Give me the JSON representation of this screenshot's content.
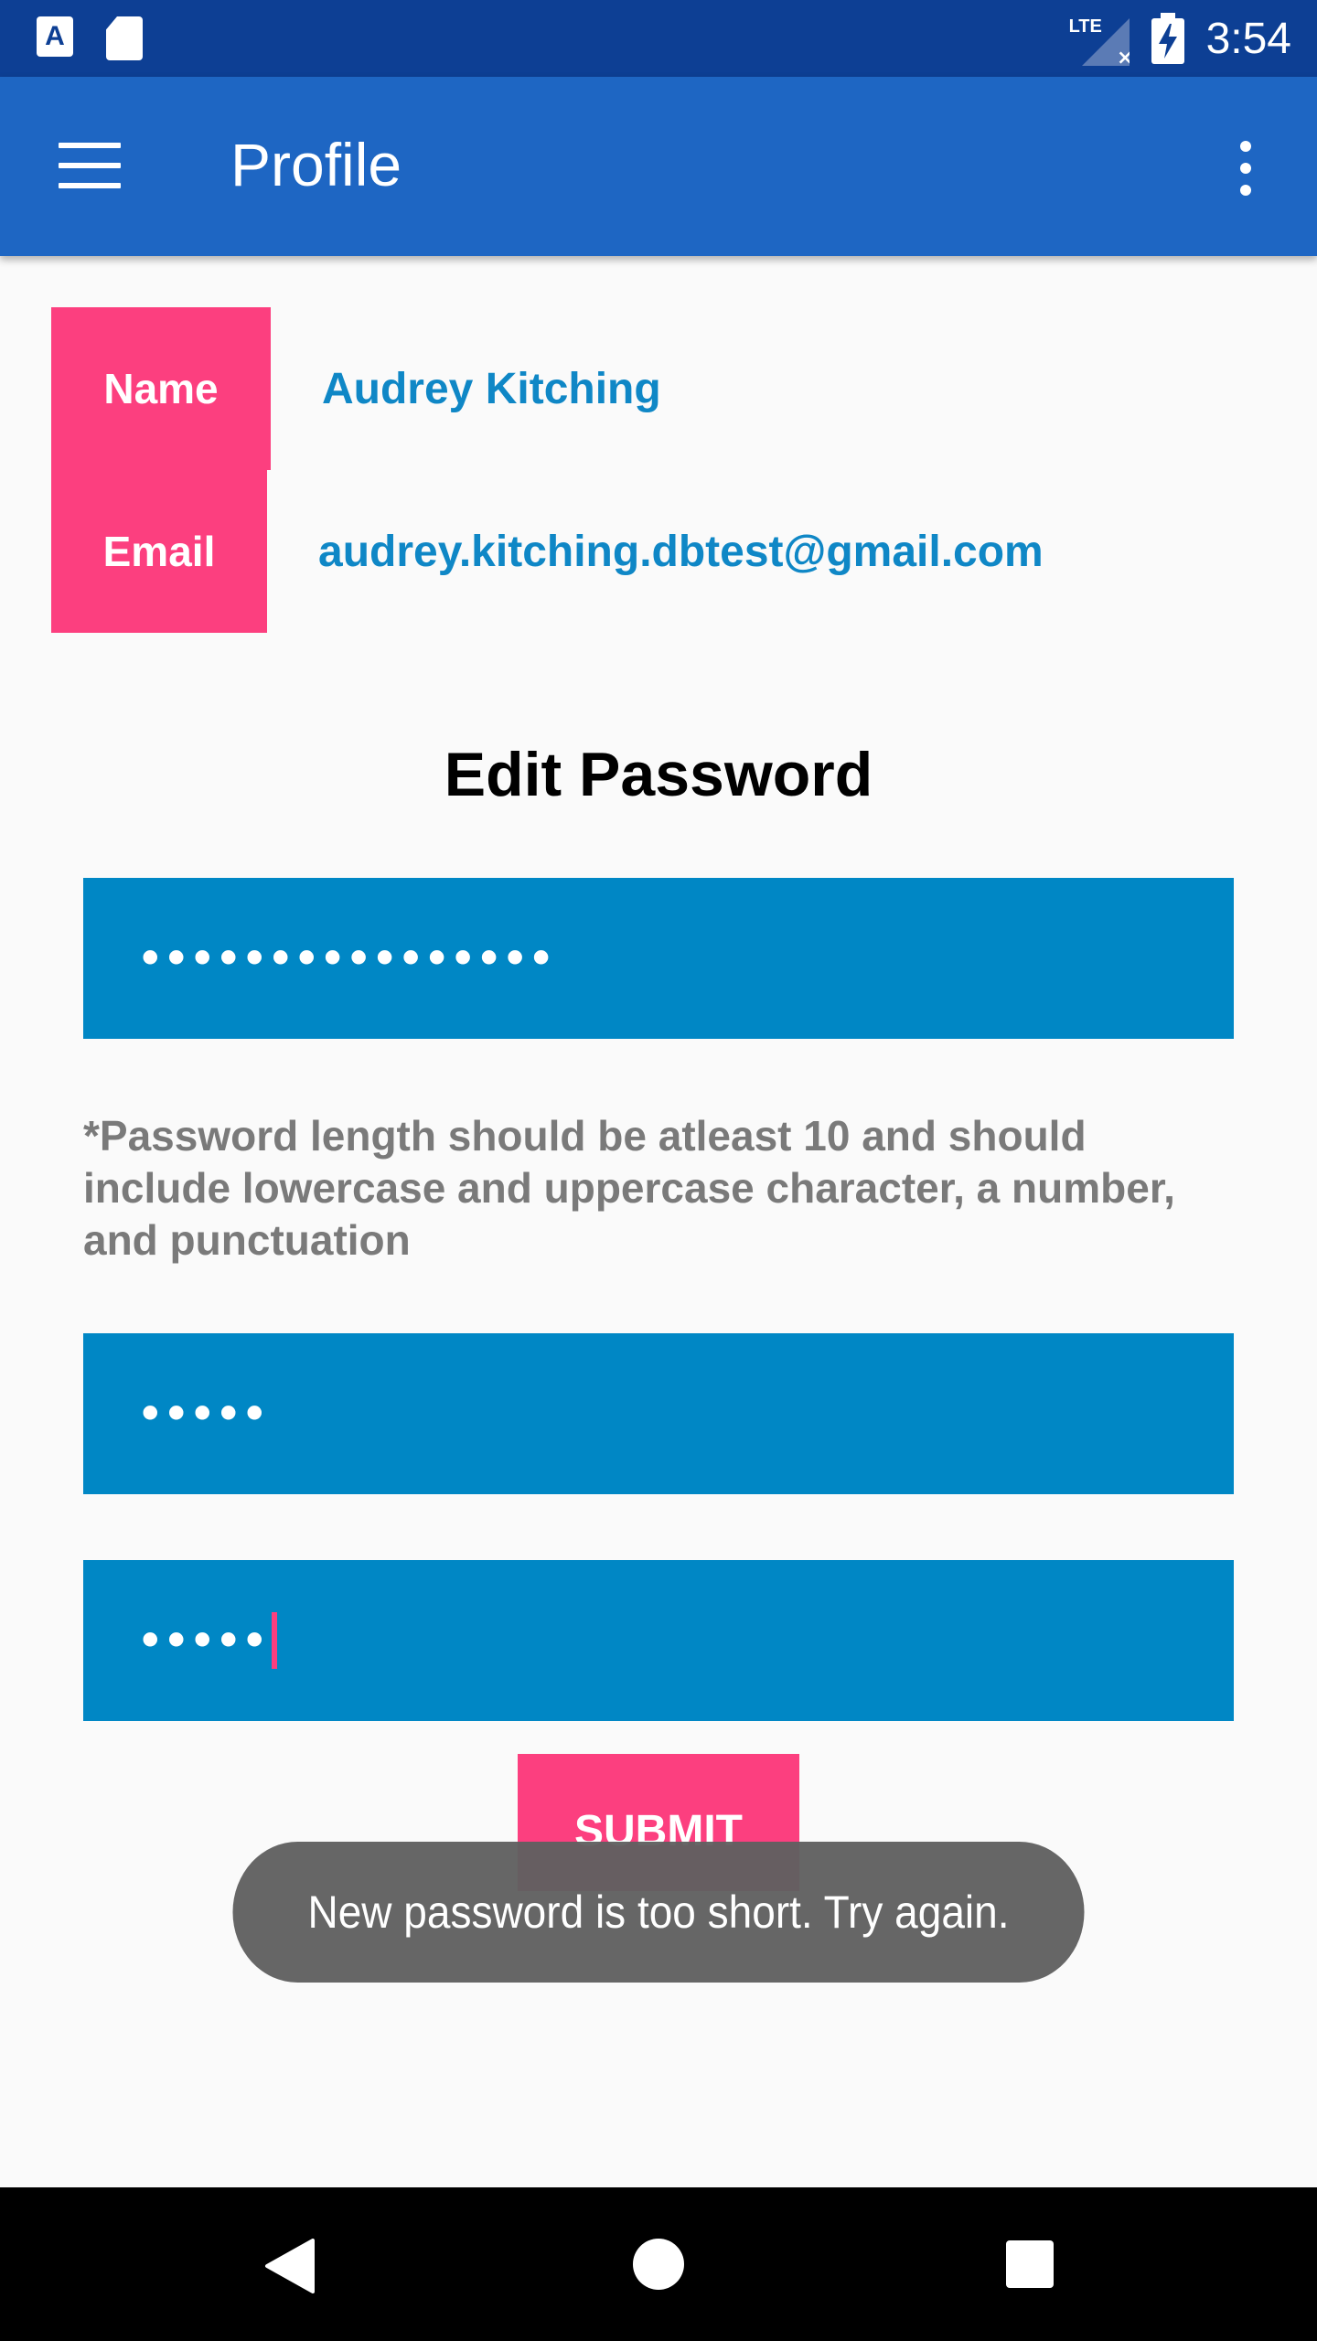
{
  "status_bar": {
    "time": "3:54",
    "network": "LTE",
    "icons": [
      "app-a-icon",
      "sd-card-icon",
      "signal-icon",
      "battery-charging-icon"
    ],
    "background_color": "#0d3f94"
  },
  "app_bar": {
    "title": "Profile",
    "menu_icon": "menu-icon",
    "overflow_icon": "more-vert-icon",
    "background_color": "#1e66c3"
  },
  "profile": {
    "name_label": "Name",
    "name_value": "Audrey Kitching",
    "email_label": "Email",
    "email_value": "audrey.kitching.dbtest@gmail.com",
    "label_color": "#fc3f7f",
    "value_color": "#0f87c6"
  },
  "edit_password": {
    "title": "Edit Password",
    "current_password_masked": "••••••••••••••••",
    "hint": "*Password length should be atleast 10 and should include lowercase and uppercase character, a number, and punctuation",
    "new_password_masked": "•••••",
    "confirm_password_masked": "•••••",
    "field_color": "#0087c5"
  },
  "submit_label": "SUBMIT",
  "toast": {
    "message": "New password is too short. Try again."
  },
  "nav_bar": {
    "icons": [
      "back-icon",
      "home-icon",
      "recents-icon"
    ]
  }
}
